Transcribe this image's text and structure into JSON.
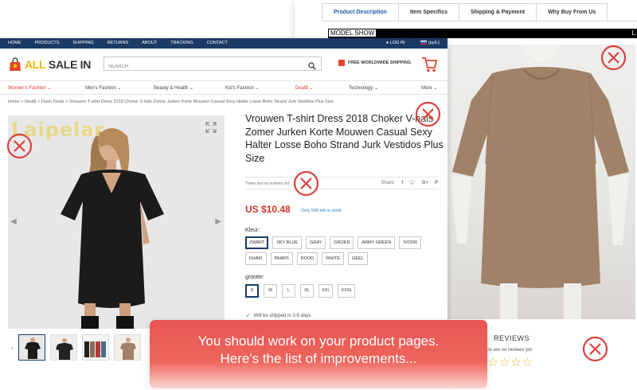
{
  "bg_page": {
    "tabs": [
      "Product Description",
      "Item Specifics",
      "Shipping & Payment",
      "Why Buy From Us"
    ],
    "model_show": "MODEL SHOW",
    "model_show_right": "L",
    "reviews_title": "REVIEWS",
    "reviews_none": "There are no reviews yet",
    "stars": "☆☆☆☆☆"
  },
  "shop": {
    "topnav": [
      "HOME",
      "PRODUCTS",
      "SHIPPING",
      "RETURNS",
      "ABOUT",
      "TRACKING",
      "CONTACT"
    ],
    "login": "LOG IN",
    "currency": "(py6.)",
    "logo_a": "ALL",
    "logo_b": "SALE IN",
    "search_placeholder": "SEARCH",
    "free_shipping": "FREE WORLDWIDE SHIPPING",
    "categories": [
      "Women's Fashion",
      "Men's Fashion",
      "Beauty & Health",
      "Kid's Fashion",
      "Deal$",
      "Technology",
      "More"
    ],
    "breadcrumb": "Home  >  Deal$  >  Flash Deals  >  Vrouwen T-shirt Dress 2018 Choker V-hals Zomer Jurken Korte Mouwen Casual Sexy Halter Losse Boho Strand Jurk Vestidos Plus Size",
    "brand_watermark": "Laipelar"
  },
  "product": {
    "title": "Vrouwen T-shirt Dress 2018 Choker V-hals Zomer Jurken Korte Mouwen Casual Sexy Halter Losse Boho Strand Jurk Vestidos Plus Size",
    "no_reviews": "There are no reviews yet",
    "share_label": "Share:",
    "price": "US $10.48",
    "stock": "Only 599 left in stock",
    "color_label": "Kleur:",
    "colors": [
      "ZWART",
      "SKY BLUE",
      "GRAY",
      "GROEN",
      "ARMY GREEN",
      "IVOOR",
      "KHAKI",
      "PAARS",
      "ROOD",
      "WHITE",
      "GEEL"
    ],
    "size_label": "grootte:",
    "sizes": [
      "S",
      "M",
      "L",
      "XL",
      "XXL",
      "XXXL"
    ],
    "shipping_note": "Will be shipped in 3-5 days"
  },
  "banner": {
    "line1": "You should work on your product pages.",
    "line2": "Here's the list of improvements..."
  },
  "colors": {
    "navy": "#1c3a66",
    "accent_red": "#d4362f",
    "banner_red": "#ee615c",
    "star_gold": "#e8b82e"
  }
}
